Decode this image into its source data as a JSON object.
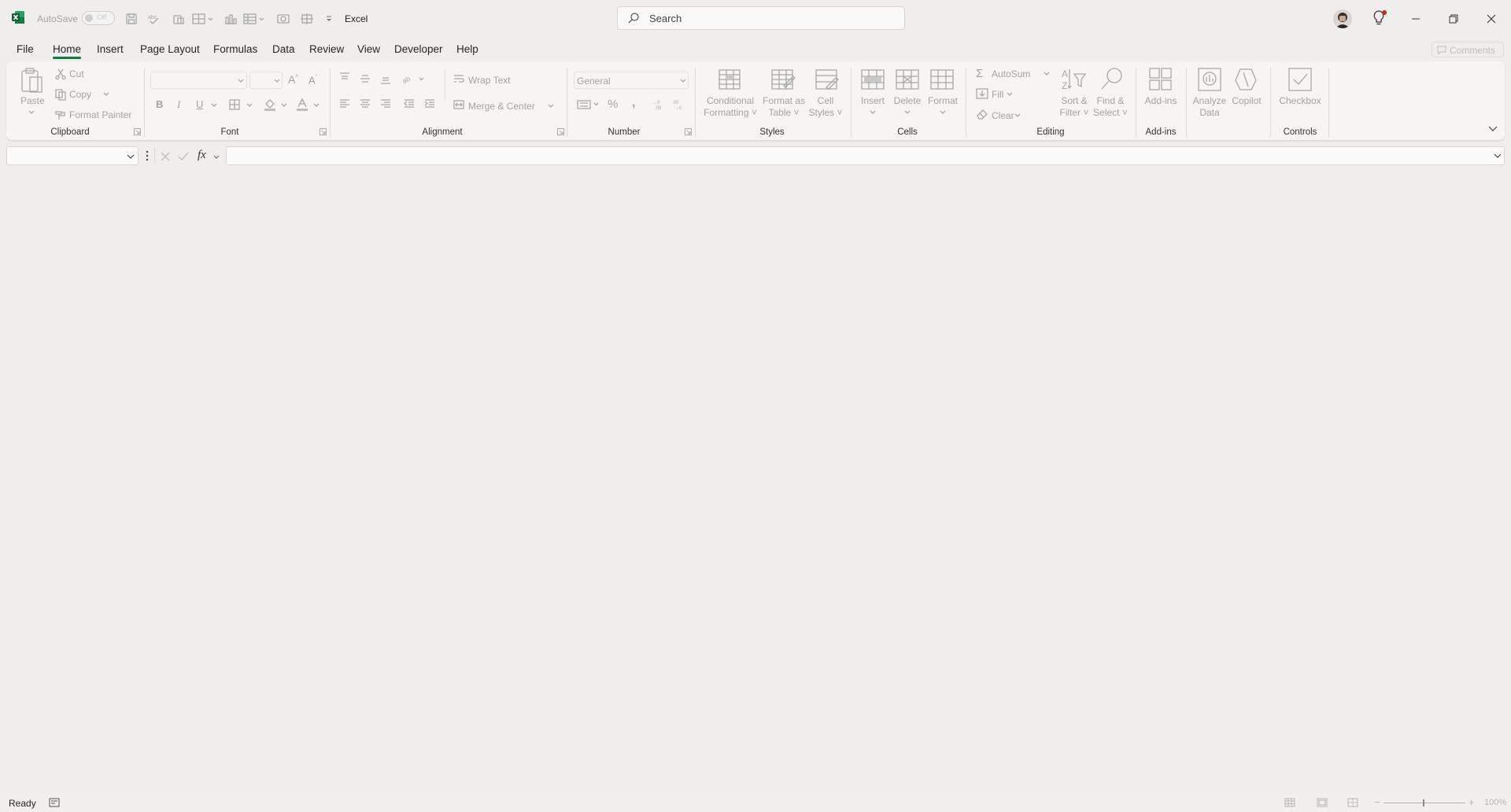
{
  "title_bar": {
    "autosave_label": "AutoSave",
    "autosave_state": "Off",
    "app_title": "Excel",
    "search_placeholder": "Search"
  },
  "menu_tabs": [
    "File",
    "Home",
    "Insert",
    "Page Layout",
    "Formulas",
    "Data",
    "Review",
    "View",
    "Developer",
    "Help"
  ],
  "active_tab": "Home",
  "comments_label": "Comments",
  "ribbon": {
    "clipboard": {
      "paste": "Paste",
      "cut": "Cut",
      "copy": "Copy",
      "format_painter": "Format Painter",
      "group": "Clipboard"
    },
    "font": {
      "bold": "B",
      "italic": "I",
      "underline": "U",
      "group": "Font"
    },
    "alignment": {
      "wrap_text": "Wrap Text",
      "merge_center": "Merge & Center",
      "group": "Alignment"
    },
    "number": {
      "format": "General",
      "group": "Number"
    },
    "styles": {
      "conditional_1": "Conditional",
      "conditional_2": "Formatting",
      "format_table_1": "Format as",
      "format_table_2": "Table",
      "cell_styles_1": "Cell",
      "cell_styles_2": "Styles",
      "group": "Styles"
    },
    "cells": {
      "insert": "Insert",
      "delete": "Delete",
      "format": "Format",
      "group": "Cells"
    },
    "editing": {
      "autosum": "AutoSum",
      "fill": "Fill",
      "clear": "Clear",
      "sort_1": "Sort &",
      "sort_2": "Filter",
      "find_1": "Find &",
      "find_2": "Select",
      "group": "Editing"
    },
    "addins": {
      "addins": "Add-ins",
      "analyze_1": "Analyze",
      "analyze_2": "Data",
      "copilot": "Copilot",
      "group": "Add-ins"
    },
    "controls": {
      "checkbox": "Checkbox",
      "group": "Controls"
    }
  },
  "formula_bar": {
    "fx": "fx"
  },
  "status_bar": {
    "status": "Ready",
    "zoom": "100%"
  }
}
